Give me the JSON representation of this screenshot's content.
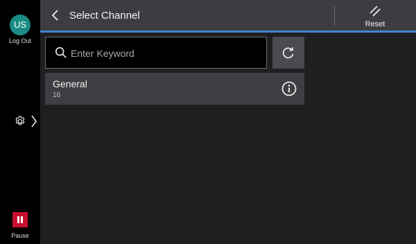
{
  "sidebar": {
    "avatar_initials": "US",
    "logout_label": "Log Out",
    "settings_icon": "gear-icon",
    "pause_label": "Pause",
    "pause_color": "#c8102e",
    "avatar_color": "#1a8c84"
  },
  "header": {
    "title": "Select Channel",
    "reset_label": "Reset",
    "accent_color": "#3f86d2"
  },
  "search": {
    "placeholder": "Enter Keyword",
    "value": ""
  },
  "channels": [
    {
      "name": "General",
      "count": "16"
    }
  ]
}
